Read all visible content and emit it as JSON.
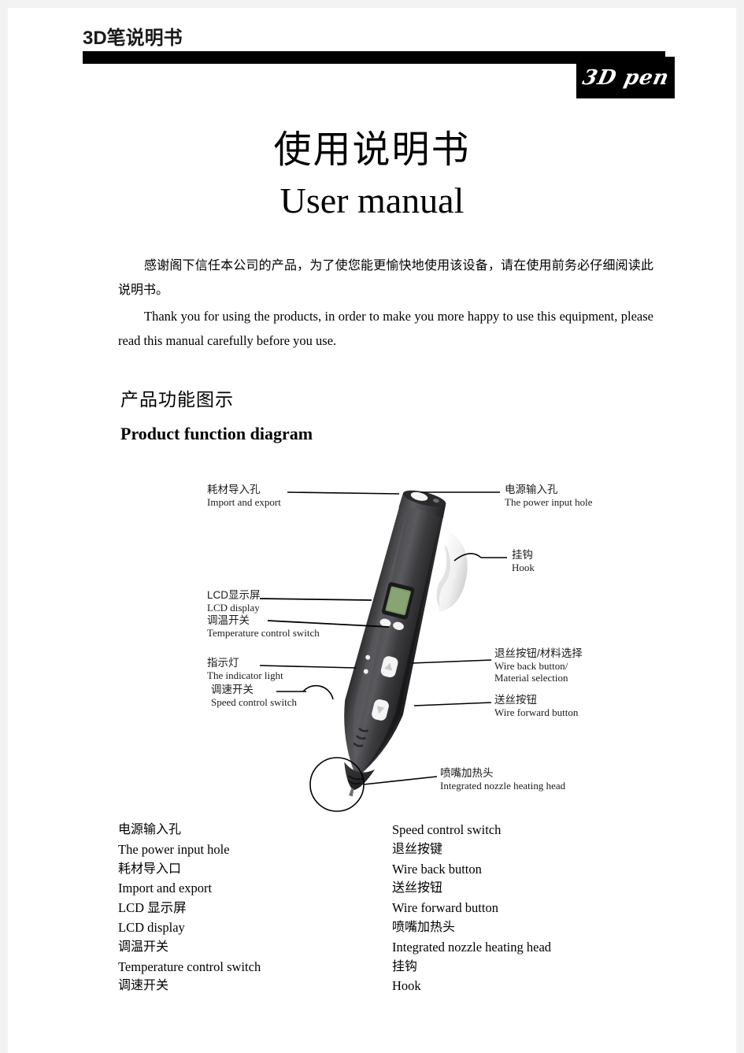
{
  "header": {
    "doc_label": "3D笔说明书",
    "logo_text": "3D pen"
  },
  "title": {
    "cn": "使用说明书",
    "en": "User manual"
  },
  "intro": {
    "cn": "感谢阁下信任本公司的产品，为了使您能更愉快地使用该设备，请在使用前务必仔细阅读此说明书。",
    "en": "Thank you for using the products, in order to make you more happy to use this equipment, please read this manual carefully before you use."
  },
  "section": {
    "cn": "产品功能图示",
    "en": "Product function diagram"
  },
  "diagram": {
    "callouts": [
      {
        "cn": "耗材导入孔",
        "en": "Import and export"
      },
      {
        "cn": "电源输入孔",
        "en": "The power input hole"
      },
      {
        "cn": "挂钩",
        "en": "Hook"
      },
      {
        "cn": "LCD显示屏",
        "en": "LCD display"
      },
      {
        "cn": "调温开关",
        "en": "Temperature control switch"
      },
      {
        "cn": "指示灯",
        "en": "The indicator light"
      },
      {
        "cn": "调速开关",
        "en": "Speed control switch"
      },
      {
        "cn": "退丝按钮/材料选择",
        "en": "Wire back button/",
        "en2": "Material selection"
      },
      {
        "cn": "送丝按钮",
        "en": "Wire forward button"
      },
      {
        "cn": "喷嘴加热头",
        "en": "Integrated nozzle heating head"
      }
    ]
  },
  "legend": {
    "left": [
      "电源输入孔",
      "The power input hole",
      "耗材导入口",
      "Import and export",
      "LCD 显示屏",
      "LCD display",
      "调温开关",
      "Temperature control switch",
      "调速开关"
    ],
    "right": [
      "Speed control switch",
      "退丝按键",
      "Wire back button",
      "送丝按钮",
      "Wire forward button",
      "喷嘴加热头",
      "Integrated nozzle heating head",
      "挂钩",
      "Hook"
    ]
  },
  "colors": {
    "page_bg": "#ffffff",
    "outer_bg": "#f2f2f2",
    "bar": "#000000",
    "pen_body": "#3a3a3c",
    "lcd_screen": "#7d9b6a"
  }
}
